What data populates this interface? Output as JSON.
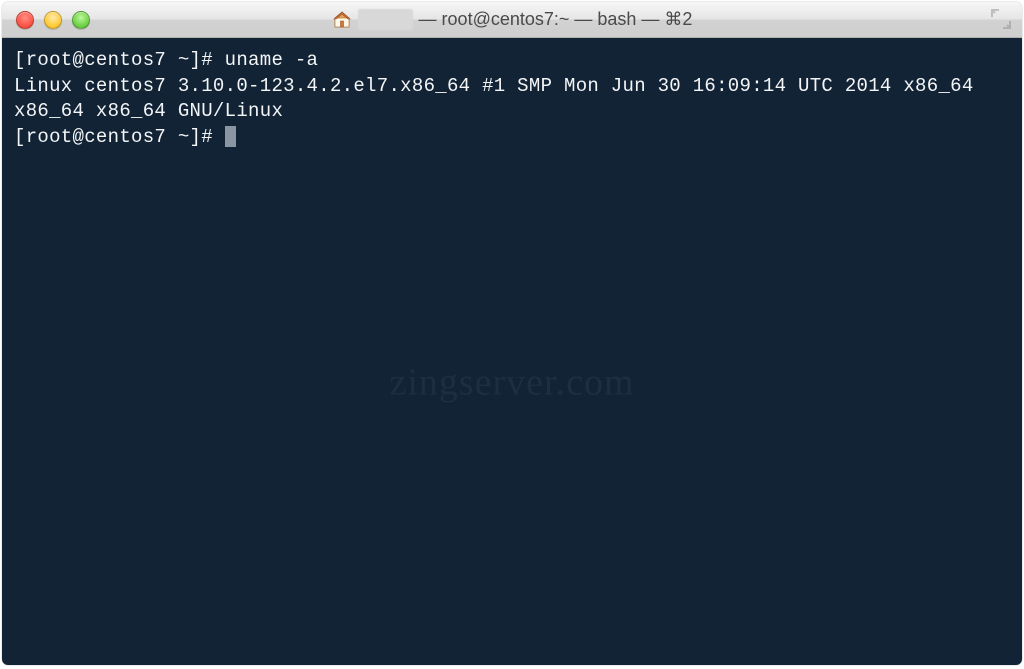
{
  "window": {
    "title_user_blurred": "           ",
    "title_rest": " — root@centos7:~ — bash — ⌘2"
  },
  "terminal": {
    "prompt1": "[root@centos7 ~]# ",
    "command1": "uname -a",
    "output1": "Linux centos7 3.10.0-123.4.2.el7.x86_64 #1 SMP Mon Jun 30 16:09:14 UTC 2014 x86_64 x86_64 x86_64 GNU/Linux",
    "prompt2": "[root@centos7 ~]# "
  },
  "watermark": "zingserver.com"
}
